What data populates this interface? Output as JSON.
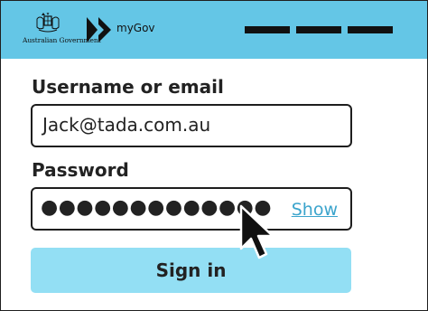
{
  "header": {
    "gov_name": "Australian Government",
    "brand": "myGov",
    "header_color": "#64c6e6",
    "menu_icon": "menu-bars"
  },
  "form": {
    "username_label": "Username or email",
    "username_value": "Jack@tada.com.au",
    "password_label": "Password",
    "password_masked": "●●●●●●●●●●●●●",
    "show_label": "Show",
    "signin_label": "Sign in",
    "button_color": "#93dff4",
    "link_color": "#3ba4cc"
  },
  "cursor": {
    "icon": "arrow-pointer-icon"
  }
}
